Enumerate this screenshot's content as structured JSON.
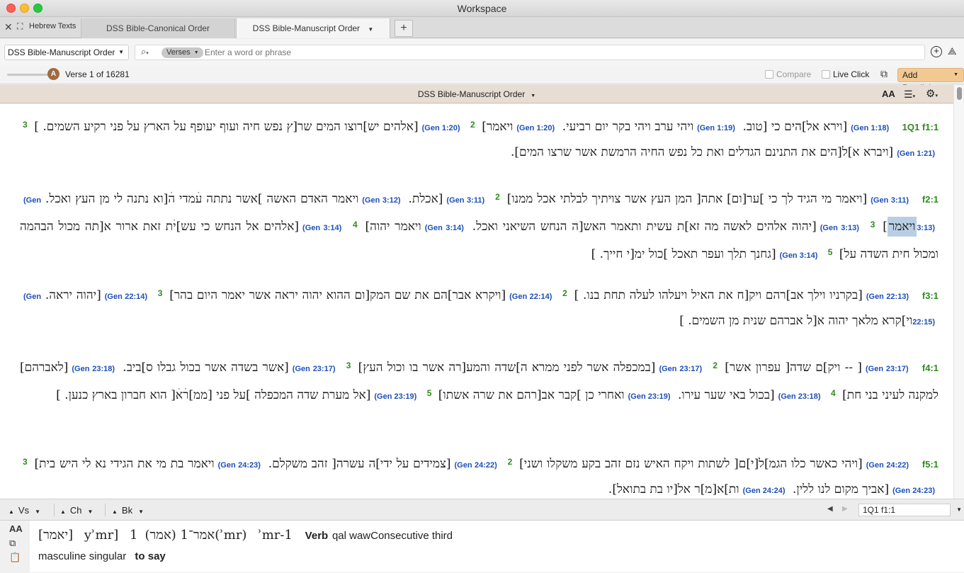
{
  "window": {
    "title": "Workspace"
  },
  "tabs": {
    "group_label": "Hebrew Texts",
    "items": [
      {
        "label": "DSS Bible-Canonical Order"
      },
      {
        "label": "DSS Bible-Manuscript Order"
      }
    ],
    "add_label": "+"
  },
  "toolbar": {
    "resource": "DSS Bible-Manuscript Order",
    "search_scope": "Verses",
    "search_placeholder": "Enter a word or phrase"
  },
  "nav": {
    "slider_badge": "A",
    "position": "Verse 1 of 16281",
    "compare_label": "Compare",
    "live_click_label": "Live Click",
    "add_parallel_label": "Add Parallel"
  },
  "panel": {
    "title": "DSS Bible-Manuscript Order",
    "font_glyph": "AA"
  },
  "text": {
    "p1": {
      "frag": "1Q1 f1:1",
      "r1": "(Gen 1:18)",
      "t1": "[וירא אל]הים כי [טוב.",
      "r2": "(Gen 1:19)",
      "t2": "ויהי ערב ויהי בקר יום רביעי.",
      "r3": "(Gen 1:20)",
      "t3": "ויאמר]",
      "v1": "2",
      "r4": "(Gen 1:20)",
      "t4": "[אלהים יש]רוצו המים שר[ץ נפש חיה ועוף יעופף על הארץ על פני רקיע השמים.",
      "t5": "]",
      "v2": "3",
      "r5": "(Gen 1:21)",
      "t6": "[ויברא א]ל[הים את התנינם הגדלים ואת כל נפש החיה הרמשת אשר שרצו המים]."
    },
    "p2": {
      "frag": "f2:1",
      "r1": "(Gen 3:11)",
      "t1": "[ויאמר מי הגיד לך כי ]ער[ום] אתה[ המן העץ אשר צויתיך לבלתי אכל ממנו]",
      "v1": "2",
      "r2": "(Gen 3:11)",
      "t2": "[אכלת.",
      "r3": "(Gen 3:12)",
      "t3": "ויאמר האדם האשה ]אשר נתתה עׄמדי הׄ[וא נתנה לי מן העץ ואכל.",
      "r4": "(Gen 3:13)",
      "t4": "ויאמר",
      "t4b": "]",
      "v2": "3",
      "r5": "(Gen 3:13)",
      "t5": "[יהוה אלהים לאשה מה זא]ת עשית ותאמר האש[ה הנחש השיאני ואכל.",
      "r6": "(Gen 3:14)",
      "t6": "ויאמר יהוה]",
      "v3": "4",
      "r7": "(Gen 3:14)",
      "t7": "[אלהים אל הנחש כי עש]יׄת זאת ארור א[תה מכול הבהמה ומכול חית השדה על]",
      "v4": "5",
      "r8": "(Gen 3:14)",
      "t8": "[גחנך תלך ועפר תאכל ]כול ימ[י חייך.",
      "t9": "]"
    },
    "p3": {
      "frag": "f3:1",
      "r1": "(Gen 22:13)",
      "t1": "[בקרניו וילך אב]רהם ויק[ח את האיל ויעלהו לעלה תחת בנו.",
      "t1b": "]",
      "v1": "2",
      "r2": "(Gen 22:14)",
      "t2": "[ויקרא אבר]הם את שם המק[ום ההוא יהוה יראה אשר יאמר היום בהר]",
      "v2": "3",
      "r3": "(Gen 22:14)",
      "t3": "[יהוה יראה.",
      "r4": "(Gen 22:15)",
      "t4": "וי]קרא מלאך יהוה א[ל אברהם שנית מן השמים.",
      "t5": "]"
    },
    "p4": {
      "frag": "f4:1",
      "r1": "(Gen 23:17)",
      "t1": "[ -- ויק]ם שדה[ עפרון אשר]",
      "v1": "2",
      "r2": "(Gen 23:17)",
      "t2": "[במכפלה אשר לפני ממרא ה]שדה והמע[רה אשר בו וכול העץ]",
      "v2": "3",
      "r3": "(Gen 23:17)",
      "t3": "[אשר בשדה אשר בכול גבלו ס]ביב.",
      "r4": "(Gen 23:18)",
      "t4": "[לאברהם] למקנה לעיני בני חת]",
      "v3": "4",
      "r5": "(Gen 23:18)",
      "t5": "[בכול באי שער עירו.",
      "r6": "(Gen 23:19)",
      "t6": "ואחרי כן ]קבר אב[רהם את שרה אשתו]",
      "v4": "5",
      "r7": "(Gen 23:19)",
      "t7": "[אל מערת שדה המכפלה ]על פני [ממ]רׄאׄ[ הוא חברון בארץ כנען.",
      "t8": "]"
    },
    "p5": {
      "frag": "f5:1",
      "r1": "(Gen 24:22)",
      "t1": "[ויהי כאשר כלו הגמ]ל[י]ם[ לשתות ויקח האיש נזם זהב בקע משקלו ושני]",
      "v1": "2",
      "r2": "(Gen 24:22)",
      "t2": "[צמידים על ידי]ה עשרה[ זהב משקלם.",
      "r3": "(Gen 24:23)",
      "t3": "ויאמר בת מי את הגידי נא לי היש בית]",
      "v2": "3",
      "r4": "(Gen 24:23)",
      "t4": "[אביך מקום לנו ללין.",
      "r5": "(Gen 24:24)",
      "t5": "ות]א[מ]ר אל[יו בת בתואל]."
    }
  },
  "bottom_nav": {
    "vs": "Vs",
    "ch": "Ch",
    "bk": "Bk",
    "reference": "1Q1 f1:1"
  },
  "info": {
    "word": "[יאמר]",
    "translit": "yʾmr]",
    "lemma_num": "1",
    "lemma_heb": "אמר־1",
    "root_paren": "(אמר)",
    "root_translit": "(ʾmr)",
    "lemma_translit": "ʾmr-1",
    "pos": "Verb",
    "parse_a": "qal wawConsecutive third",
    "parse_b": "masculine singular",
    "gloss": "to say"
  }
}
